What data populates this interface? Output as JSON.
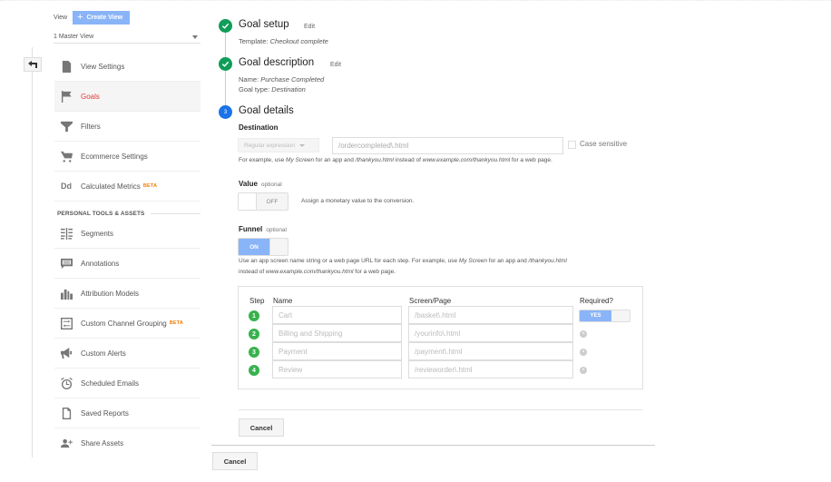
{
  "sidebar": {
    "view_label": "View",
    "create_view_label": "Create View",
    "selected_view": "1 Master View",
    "items": [
      {
        "label": "View Settings",
        "icon": "document-icon"
      },
      {
        "label": "Goals",
        "icon": "flag-icon",
        "active": true
      },
      {
        "label": "Filters",
        "icon": "filter-icon"
      },
      {
        "label": "Ecommerce Settings",
        "icon": "cart-icon"
      },
      {
        "label": "Calculated Metrics",
        "icon": "dd-icon",
        "badge": "BETA"
      }
    ],
    "section_title": "PERSONAL TOOLS & ASSETS",
    "personal_items": [
      {
        "label": "Segments",
        "icon": "segments-icon"
      },
      {
        "label": "Annotations",
        "icon": "comment-icon"
      },
      {
        "label": "Attribution Models",
        "icon": "bar-chart-icon"
      },
      {
        "label": "Custom Channel Grouping",
        "icon": "channel-grouping-icon",
        "badge": "BETA"
      },
      {
        "label": "Custom Alerts",
        "icon": "megaphone-icon"
      },
      {
        "label": "Scheduled Emails",
        "icon": "alarm-clock-icon"
      },
      {
        "label": "Saved Reports",
        "icon": "saved-report-icon"
      },
      {
        "label": "Share Assets",
        "icon": "add-person-icon"
      }
    ]
  },
  "steps": [
    {
      "number": "1",
      "status": "complete",
      "title": "Goal setup",
      "edit_label": "Edit",
      "details": [
        {
          "label": "Template:",
          "value": "Checkout complete"
        }
      ]
    },
    {
      "number": "2",
      "status": "complete",
      "title": "Goal description",
      "edit_label": "Edit",
      "details": [
        {
          "label": "Name:",
          "value": "Purchase Completed"
        },
        {
          "label": "Goal type:",
          "value": "Destination"
        }
      ]
    },
    {
      "number": "3",
      "status": "current",
      "title": "Goal details"
    }
  ],
  "goal_details": {
    "destination": {
      "label": "Destination",
      "match_type": "Regular expression",
      "value": "/ordercompleted\\.html",
      "case_sensitive_label": "Case sensitive",
      "case_sensitive": false,
      "hint": {
        "p1": "For example, use ",
        "i1": "My Screen",
        "p2": " for an app and ",
        "i2": "/thankyou.html",
        "p3": " instead of ",
        "i3": "www.example.com/thankyou.html",
        "p4": " for a web page."
      }
    },
    "value": {
      "label": "Value",
      "optional": "optional",
      "toggle_state": "OFF",
      "description": "Assign a monetary value to the conversion."
    },
    "funnel": {
      "label": "Funnel",
      "optional": "optional",
      "toggle_state": "ON",
      "hint": {
        "p1": "Use an app screen name string or a web page URL for each step. For example, use ",
        "i1": "My Screen",
        "p2": " for an app and ",
        "i2": "/thankyou.html",
        "p3": "instead of ",
        "i3": "www.example.com/thankyou.html",
        "p4": " for a web page."
      },
      "columns": {
        "step": "Step",
        "name": "Name",
        "screen": "Screen/Page",
        "required": "Required?"
      },
      "rows": [
        {
          "step": "1",
          "name": "Cart",
          "screen": "/basket\\.html",
          "required": "YES"
        },
        {
          "step": "2",
          "name": "Billing and Shipping",
          "screen": "/yourinfo\\.html"
        },
        {
          "step": "3",
          "name": "Payment",
          "screen": "/payment\\.html"
        },
        {
          "step": "4",
          "name": "Review",
          "screen": "/revieworder\\.html"
        }
      ]
    },
    "cancel_label": "Cancel"
  },
  "footer": {
    "cancel_label": "Cancel"
  },
  "colors": {
    "accent_blue": "#8ab4f8",
    "active_red": "#e53935",
    "complete_green": "#0f9d58",
    "current_blue": "#1a73e8",
    "beta_orange": "#f57c00",
    "funnel_step_green": "#37b24d"
  }
}
